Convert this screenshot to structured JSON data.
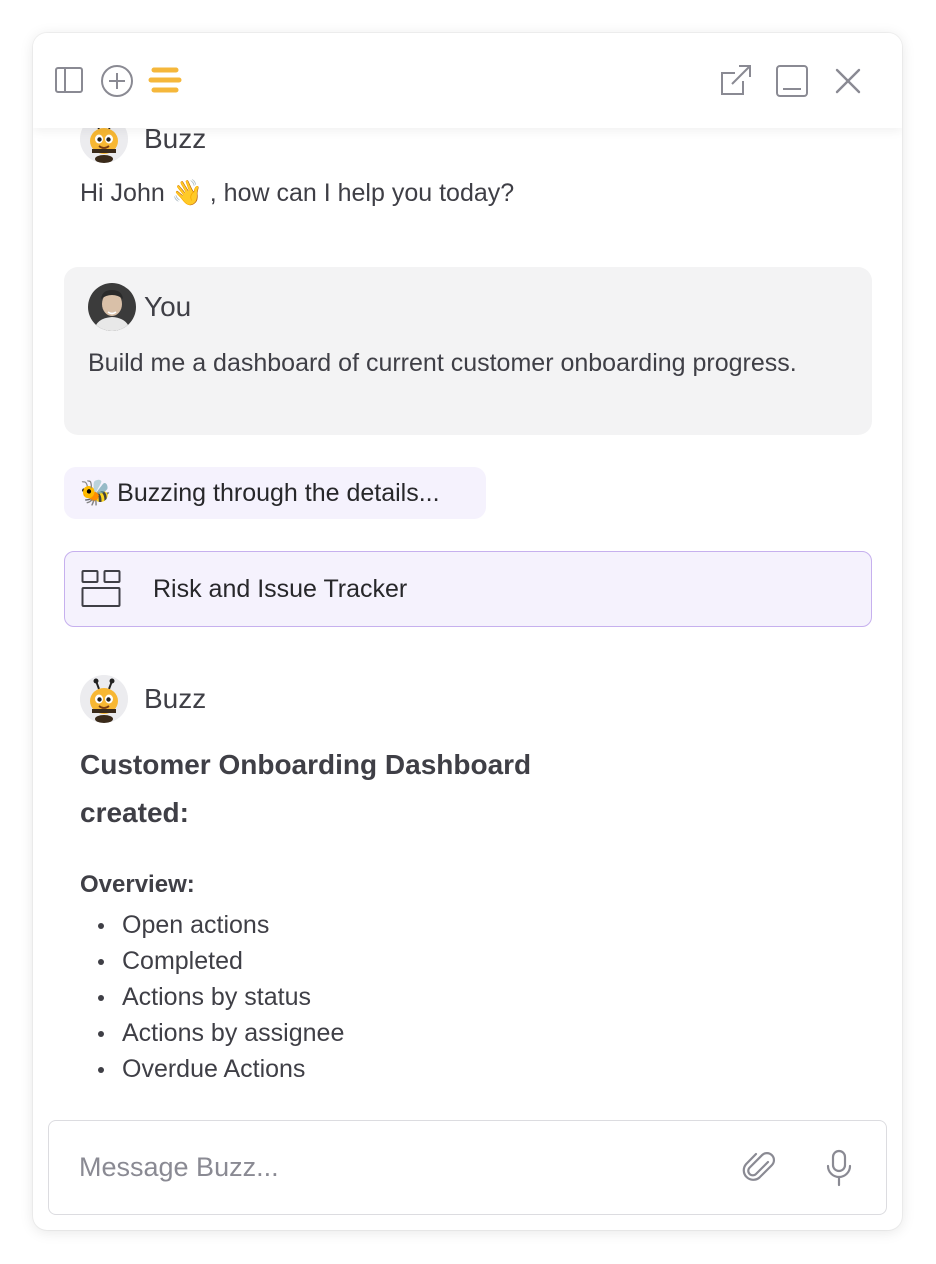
{
  "header": {
    "icons": [
      "sidebar-toggle-icon",
      "new-chat-icon",
      "buzz-logo-icon",
      "open-external-icon",
      "minimize-icon",
      "close-icon"
    ],
    "accent_color": "#f5b73b"
  },
  "conversation": {
    "assistant_name": "Buzz",
    "greeting": "Hi John 👋 , how can I help you today?",
    "user": {
      "name": "You",
      "message": "Build me a dashboard of current customer onboarding progress."
    },
    "status": {
      "emoji": "🐝",
      "text": "Buzzing through the details..."
    },
    "artifact": {
      "label": "Risk and Issue Tracker"
    },
    "response": {
      "sender": "Buzz",
      "title": "Customer Onboarding Dashboard created:",
      "overview_label": "Overview:",
      "items": [
        "Open actions",
        "Completed",
        "Actions by status",
        "Actions by assignee",
        "Overdue Actions"
      ]
    }
  },
  "composer": {
    "placeholder": "Message Buzz...",
    "value": ""
  },
  "colors": {
    "purple_tint": "#f5f2fd",
    "purple_border": "#c6b0ee",
    "user_bubble": "#f3f3f4"
  }
}
